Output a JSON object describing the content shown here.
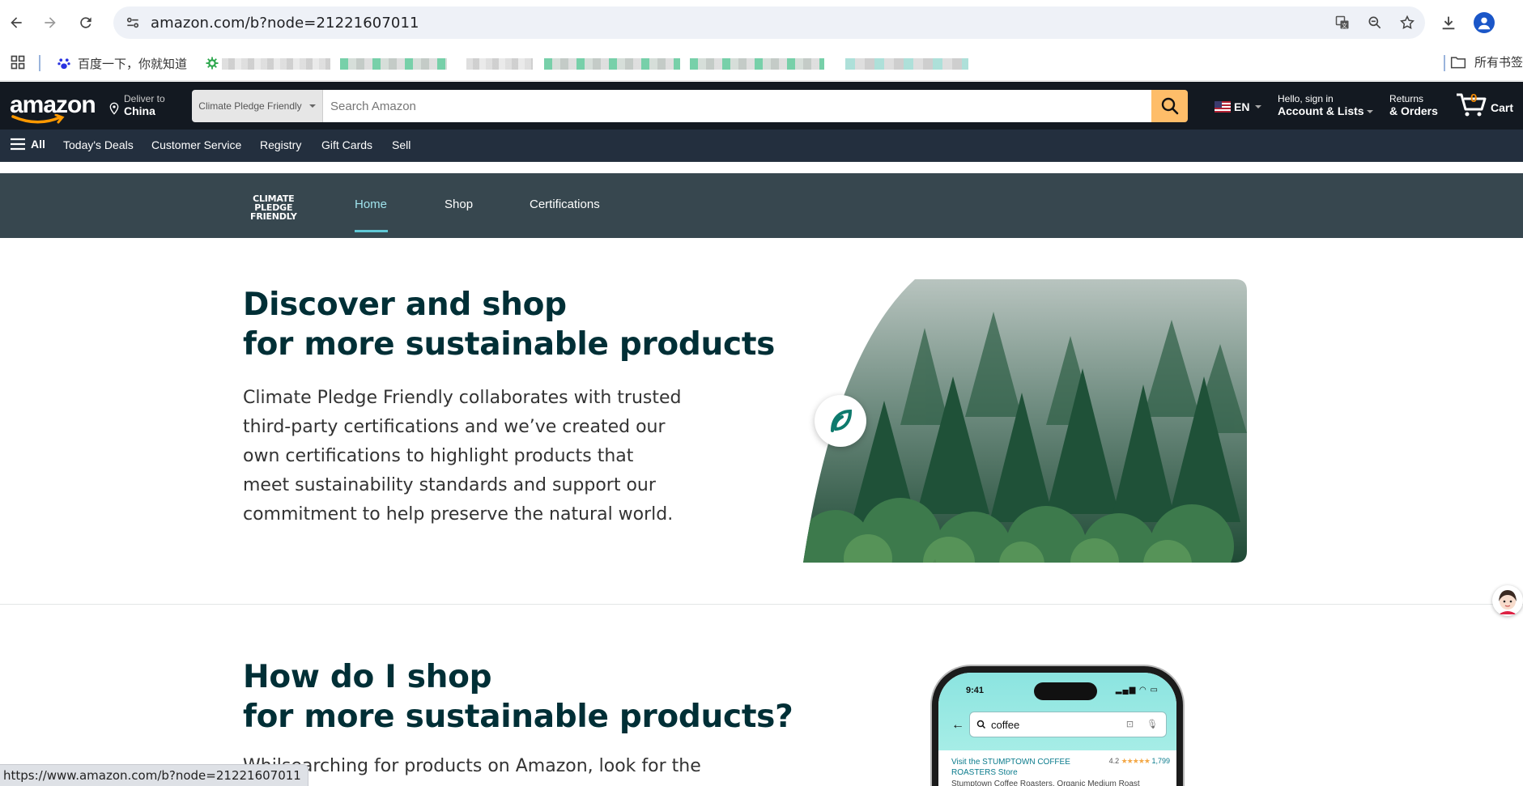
{
  "browser": {
    "url": "amazon.com/b?node=21221607011",
    "bookmarks": [
      {
        "label": "百度一下，你就知道"
      }
    ],
    "bookmark_folder": "所有书签"
  },
  "header": {
    "logo": "amazon",
    "deliver_line1": "Deliver to",
    "deliver_line2": "China",
    "search_category": "Climate Pledge Friendly",
    "search_placeholder": "Search Amazon",
    "language": "EN",
    "account_line1": "Hello, sign in",
    "account_line2": "Account & Lists",
    "returns_line1": "Returns",
    "returns_line2": "& Orders",
    "cart_count": "0",
    "cart_label": "Cart"
  },
  "subnav": {
    "all": "All",
    "items": [
      "Today's Deals",
      "Customer Service",
      "Registry",
      "Gift Cards",
      "Sell"
    ]
  },
  "cpf": {
    "logo_lines": [
      "CLIMATE",
      "PLEDGE",
      "FRIENDLY"
    ],
    "tabs": [
      "Home",
      "Shop",
      "Certifications"
    ],
    "active_tab": "Home"
  },
  "hero": {
    "title_line1": "Discover and shop",
    "title_line2": "for more sustainable products",
    "body": "Climate Pledge Friendly collaborates with trusted third-party certifications and we’ve created our own certifications to highlight products that meet sustainability standards and support our commitment to help preserve the natural world."
  },
  "how": {
    "title_line1": "How do I shop",
    "title_line2": "for more sustainable products?",
    "body": "searching for products on Amazon, look for the"
  },
  "phone": {
    "time": "9:41",
    "search": "coffee",
    "store_link": "Visit the STUMPTOWN COFFEE ROASTERS Store",
    "rating": "4.2",
    "stars": "★★★★★",
    "review_count": "1,799",
    "product": "Stumptown Coffee Roasters, Organic Medium Roast"
  },
  "status_url": "https://www.amazon.com/b?node=21221607011",
  "colors": {
    "amazon_dark": "#131921",
    "amazon_subnav": "#232f3e",
    "search_button": "#febd69",
    "cpf_band": "#37474f",
    "heading": "#002f36"
  }
}
